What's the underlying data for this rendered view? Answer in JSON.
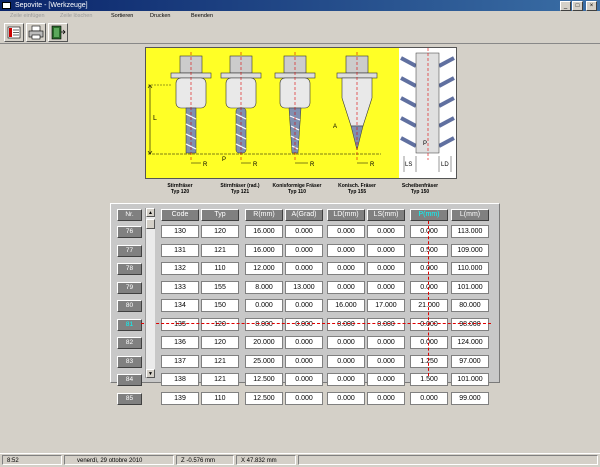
{
  "window": {
    "title": "Sepovite - [Werkzeuge]"
  },
  "menu": [
    "Zeile einfügen",
    "Zeile löschen",
    "Sortieren",
    "Drucken",
    "Beenden"
  ],
  "tools": [
    {
      "name": "Stirnfräser",
      "type": "Typ 120"
    },
    {
      "name": "Stirnfräser (rad.)",
      "type": "Typ 121"
    },
    {
      "name": "Konisformige Fräser",
      "type": "Typ 110"
    },
    {
      "name": "Konisch. Fräser",
      "type": "Typ 155"
    },
    {
      "name": "Scheibenfräser",
      "type": "Typ 150"
    }
  ],
  "diagram_labels": {
    "L": "L",
    "R": "R",
    "P": "P",
    "A": "A",
    "LS": "LS",
    "LD": "LD"
  },
  "table": {
    "nr_header": "Nr.",
    "columns": [
      "Code",
      "Typ",
      "R(mm)",
      "A(Grad)",
      "LD(mm)",
      "LS(mm)",
      "P(mm)",
      "L(mm)"
    ],
    "active_column": 6,
    "active_row": 5,
    "rows": [
      {
        "nr": "76",
        "cells": [
          "130",
          "120",
          "16.000",
          "0.000",
          "0.000",
          "0.000",
          "0.000",
          "113.000"
        ]
      },
      {
        "nr": "77",
        "cells": [
          "131",
          "121",
          "16.000",
          "0.000",
          "0.000",
          "0.000",
          "0.500",
          "109.000"
        ]
      },
      {
        "nr": "78",
        "cells": [
          "132",
          "110",
          "12.000",
          "0.000",
          "0.000",
          "0.000",
          "0.000",
          "110.000"
        ]
      },
      {
        "nr": "79",
        "cells": [
          "133",
          "155",
          "8.000",
          "13.000",
          "0.000",
          "0.000",
          "0.000",
          "101.000"
        ]
      },
      {
        "nr": "80",
        "cells": [
          "134",
          "150",
          "0.000",
          "0.000",
          "16.000",
          "17.000",
          "21.000",
          "80.000"
        ]
      },
      {
        "nr": "81",
        "cells": [
          "135",
          "120",
          "8.000",
          "0.000",
          "0.000",
          "0.000",
          "0.000",
          "98.000"
        ]
      },
      {
        "nr": "82",
        "cells": [
          "136",
          "120",
          "20.000",
          "0.000",
          "0.000",
          "0.000",
          "0.000",
          "124.000"
        ]
      },
      {
        "nr": "83",
        "cells": [
          "137",
          "121",
          "25.000",
          "0.000",
          "0.000",
          "0.000",
          "1.250",
          "97.000"
        ]
      },
      {
        "nr": "84",
        "cells": [
          "138",
          "121",
          "12.500",
          "0.000",
          "0.000",
          "0.000",
          "1.500",
          "101.000"
        ]
      },
      {
        "nr": "85",
        "cells": [
          "139",
          "110",
          "12.500",
          "0.000",
          "0.000",
          "0.000",
          "0.000",
          "99.000"
        ]
      }
    ]
  },
  "status": {
    "time": "8:52",
    "date": "venerdì, 29 ottobre 2010",
    "z": "Z -0.576 mm",
    "x": "X 47.832 mm"
  },
  "colors": {
    "diagram_bg": "#ffff26",
    "active": "#00ffff",
    "title_bar": "#0a246a"
  }
}
